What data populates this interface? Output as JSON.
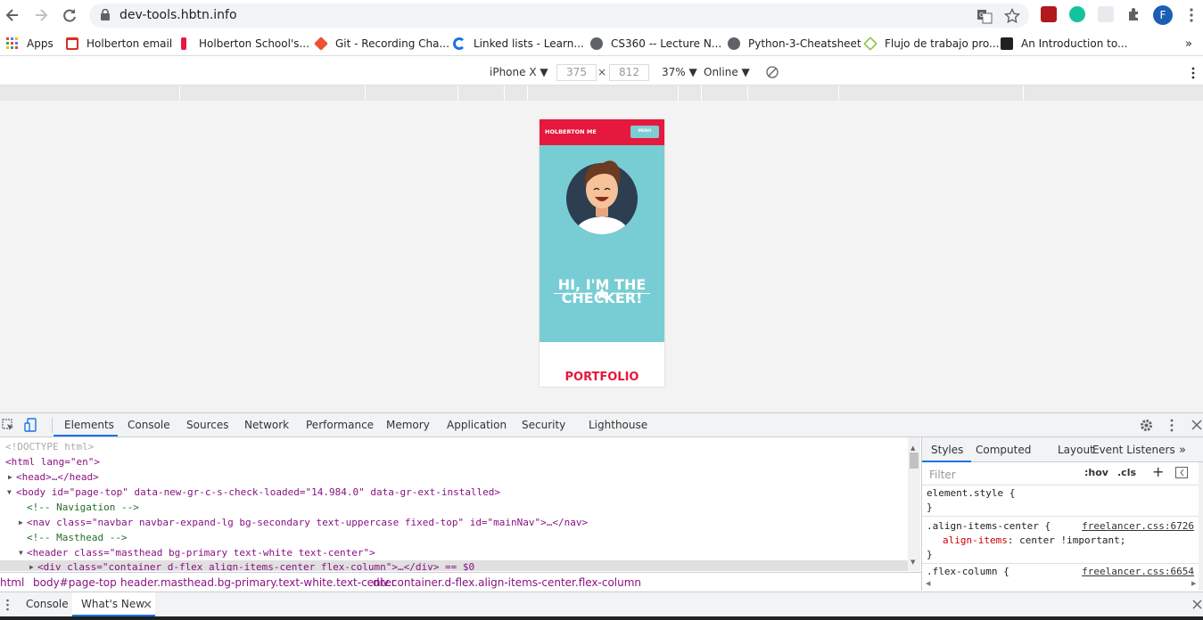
{
  "browser": {
    "url": "dev-tools.hbtn.info",
    "profile_initial": "F"
  },
  "bookmarks": [
    {
      "label": "Apps",
      "color": "#ea4335"
    },
    {
      "label": "Holberton email",
      "color": "#d93025"
    },
    {
      "label": "Holberton School's...",
      "color": "#e5183d"
    },
    {
      "label": "Git - Recording Cha...",
      "color": "#f05033"
    },
    {
      "label": "Linked lists - Learn...",
      "color": "#1a73e8"
    },
    {
      "label": "CS360 -- Lecture N...",
      "color": "#5f6368"
    },
    {
      "label": "Python-3-Cheatsheet",
      "color": "#5f6368"
    },
    {
      "label": "Flujo de trabajo pro...",
      "color": "#8bc34a"
    },
    {
      "label": "An Introduction to...",
      "color": "#202124"
    }
  ],
  "device_toolbar": {
    "device": "iPhone X",
    "width": "375",
    "height": "812",
    "times": "×",
    "zoom": "37%",
    "network": "Online"
  },
  "page": {
    "brand": "HOLBERTON ME",
    "menu": "MENU",
    "headline_1": "HI, I'M THE",
    "headline_2": "CHECKER!",
    "portfolio": "PORTFOLIO"
  },
  "devtools": {
    "tabs": [
      "Elements",
      "Console",
      "Sources",
      "Network",
      "Performance",
      "Memory",
      "Application",
      "Security",
      "Lighthouse"
    ],
    "active_tab": "Elements",
    "dom_lines": [
      "<!DOCTYPE html>",
      "<html lang=\"en\">",
      "<head>…</head>",
      "<body id=\"page-top\" data-new-gr-c-s-check-loaded=\"14.984.0\" data-gr-ext-installed>",
      "<!-- Navigation -->",
      "<nav class=\"navbar navbar-expand-lg bg-secondary text-uppercase fixed-top\" id=\"mainNav\">…</nav>",
      "<!-- Masthead -->",
      "<header class=\"masthead bg-primary text-white text-center\">",
      "<div class=\"container d-flex align-items-center flex-column\">…</div> == $0"
    ],
    "styles_tabs": [
      "Styles",
      "Computed",
      "Layout",
      "Event Listeners"
    ],
    "filter_placeholder": "Filter",
    "hov": ":hov",
    "cls": ".cls",
    "rules": {
      "element_style": "element.style {",
      "close": "}",
      "rule1_selector": ".align-items-center {",
      "rule1_source": "freelancer.css:6726",
      "rule1_prop": "align-items",
      "rule1_value": "center !important;",
      "rule2_selector": ".flex-column {",
      "rule2_source": "freelancer.css:6654"
    },
    "breadcrumbs": [
      "html",
      "body#page-top",
      "header.masthead.bg-primary.text-white.text-center",
      "div.container.d-flex.align-items-center.flex-column"
    ],
    "drawer_tabs": [
      "Console",
      "What's New"
    ]
  }
}
